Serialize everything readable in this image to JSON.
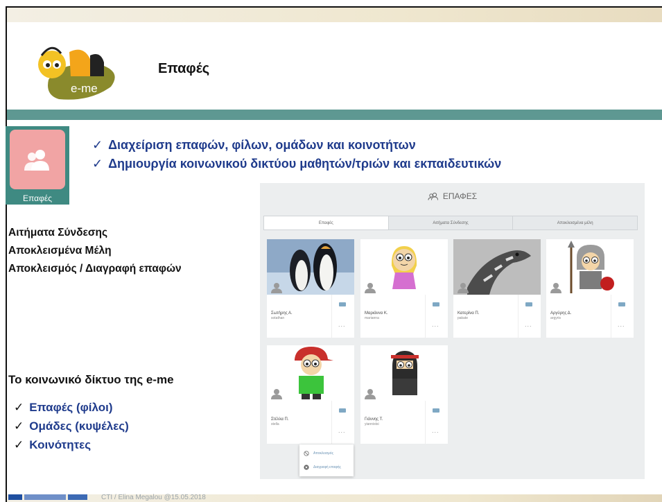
{
  "slide": {
    "title": "Επαφές",
    "logo_text": "e-me",
    "app_icon_label": "Επαφές",
    "top_bullets": [
      "Διαχείριση επαφών, φίλων, ομάδων και κοινοτήτων",
      "Δημιουργία κοινωνικού δικτύου μαθητών/τριών και εκπαιδευτικών"
    ],
    "left_items": [
      "Αιτήματα Σύνδεσης",
      "Αποκλεισμένα Μέλη",
      "Αποκλεισμός / Διαγραφή επαφών"
    ],
    "social_title": "Το κοινωνικό δίκτυο της e-me",
    "social_bullets": [
      "Επαφές (φίλοι)",
      "Ομάδες (κυψέλες)",
      "Κοινότητες"
    ],
    "check_mark": "✓",
    "footer": "CTI / Elina Megalou @15.05.2018"
  },
  "app": {
    "header": "ΕΠΑΦΕΣ",
    "tabs": [
      {
        "label": "Επαφές",
        "active": true
      },
      {
        "label": "Αιτήματα Σύνδεσης",
        "active": false
      },
      {
        "label": "Αποκλεισμένα μέλη",
        "active": false
      }
    ],
    "contacts": [
      {
        "name": "Σωτήρης Α.",
        "username": "sotathan",
        "picture": "penguins"
      },
      {
        "name": "Μαριάννα Κ.",
        "username": "marianna",
        "picture": "girl-avatar"
      },
      {
        "name": "Κατερίνα Π.",
        "username": "pakate",
        "picture": "giraffe"
      },
      {
        "name": "Αργύρης Δ.",
        "username": "argyris",
        "picture": "knight-avatar"
      },
      {
        "name": "Στέλλα Π.",
        "username": "stella",
        "picture": "cap-boy-avatar"
      },
      {
        "name": "Γιάννης Τ.",
        "username": "yiannistsi",
        "picture": "ninja-avatar"
      }
    ],
    "more_label": "...",
    "context_menu": [
      {
        "label": "Αποκλεισμός",
        "icon": "block-icon"
      },
      {
        "label": "Διαγραφή επαφής",
        "icon": "delete-icon"
      }
    ]
  },
  "colors": {
    "accent_bar": "#5e9892",
    "title_blue": "#1f3b8c",
    "app_tile": "#f1a4a4"
  }
}
